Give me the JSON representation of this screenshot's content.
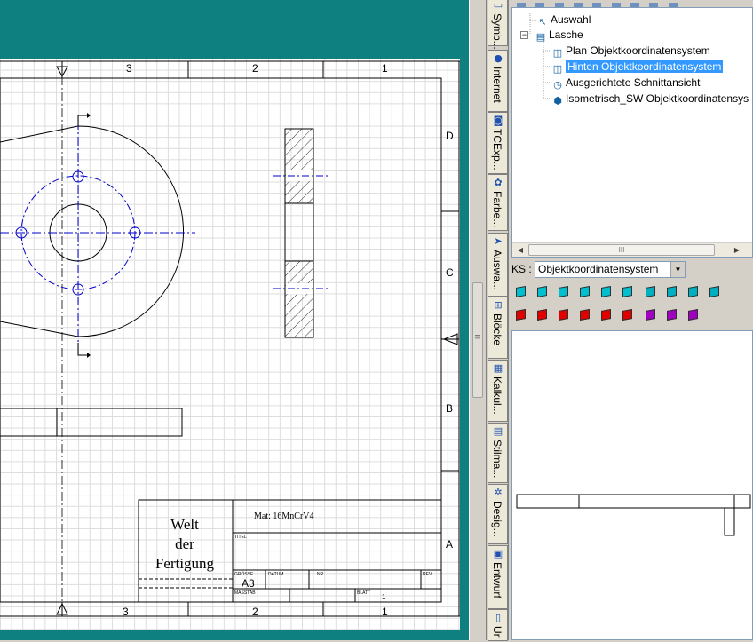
{
  "drawing": {
    "zone_numbers_top": [
      "3",
      "2",
      "1"
    ],
    "zone_numbers_bottom": [
      "3",
      "2",
      "1"
    ],
    "zone_letters": [
      "D",
      "C",
      "B",
      "A"
    ],
    "title_block": {
      "company_line1": "Welt",
      "company_line2": "der",
      "company_line3": "Fertigung",
      "material": "Mat: 16MnCrV4",
      "titel_label": "TITEL",
      "groesse_label": "GRÖSSE",
      "groesse_value": "A3",
      "datum_label": "DATUM",
      "nr_label": "NR",
      "rev_label": "REV",
      "massstab_label": "MASSTAB",
      "blatt_label": "BLATT",
      "blatt_value": "1"
    }
  },
  "sidebar_tabs": [
    {
      "label": "Symb...",
      "icon": "symbol-icon"
    },
    {
      "label": "Internet",
      "icon": "globe-icon"
    },
    {
      "label": "TCExp...",
      "icon": "explorer-icon"
    },
    {
      "label": "Farbe...",
      "icon": "palette-icon"
    },
    {
      "label": "Auswa...",
      "icon": "cursor-icon"
    },
    {
      "label": "Blöcke",
      "icon": "block-icon"
    },
    {
      "label": "Kalkul...",
      "icon": "calculator-icon"
    },
    {
      "label": "Stilma...",
      "icon": "style-icon"
    },
    {
      "label": "Desig...",
      "icon": "design-icon"
    },
    {
      "label": "Entwurf",
      "icon": "draft-icon"
    },
    {
      "label": "Ur",
      "icon": "document-icon"
    }
  ],
  "tree": {
    "items": [
      {
        "label": "Auswahl",
        "icon": "select-arrow-icon"
      },
      {
        "label": "Lasche",
        "icon": "document-tree-icon"
      },
      {
        "label": "Plan Objektkoordinatensystem",
        "icon": "view-icon"
      },
      {
        "label": "Hinten Objektkoordinatensystem",
        "icon": "view-icon"
      },
      {
        "label": "Ausgerichtete Schnittansicht",
        "icon": "section-view-icon"
      },
      {
        "label": "Isometrisch_SW Objektkoordinatensys",
        "icon": "iso-view-icon"
      }
    ],
    "scroll_grip": "III"
  },
  "ks": {
    "label": "KS :",
    "value": "Objektkoordinatensystem"
  },
  "view_buttons_row1": [
    "#00c0d0",
    "#00c0d0",
    "#00c0d0",
    "#00c0d0",
    "#00c0d0",
    "#00c0d0",
    "#00b0c0",
    "#00b0c0",
    "#00b0c0",
    "#00b0c0"
  ],
  "view_buttons_row2": [
    "#e00000",
    "#e00000",
    "#e00000",
    "#e00000",
    "#e00000",
    "#e00000",
    "#a000c0",
    "#a000c0",
    "#a000c0"
  ],
  "colors": {
    "background": "#0f8080",
    "centerline": "#0000cc",
    "selection": "#3399ff"
  }
}
